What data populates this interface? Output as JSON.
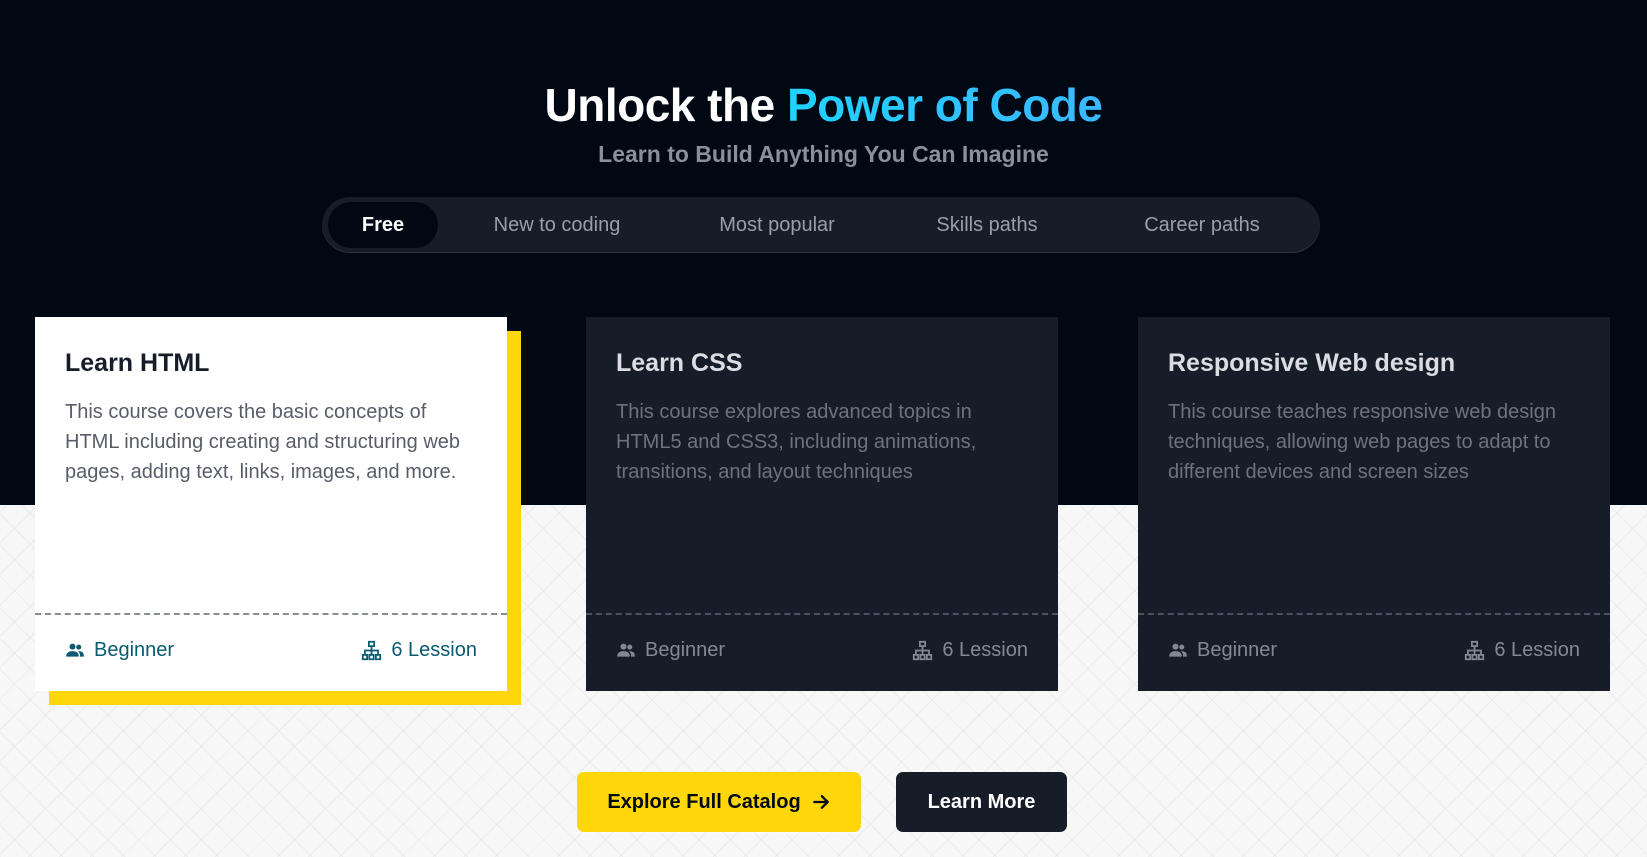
{
  "hero": {
    "title_prefix": "Unlock the",
    "title_highlight": "Power of Code",
    "subtitle": "Learn to Build Anything You Can Imagine"
  },
  "tabs": [
    {
      "label": "Free",
      "active": true
    },
    {
      "label": "New to coding",
      "active": false
    },
    {
      "label": "Most popular",
      "active": false
    },
    {
      "label": "Skills paths",
      "active": false
    },
    {
      "label": "Career paths",
      "active": false
    }
  ],
  "cards": [
    {
      "title": "Learn HTML",
      "description": "This course covers the basic concepts of HTML including creating and structuring web pages, adding text, links, images, and more.",
      "level": "Beginner",
      "lessons": "6 Lession",
      "highlighted": true
    },
    {
      "title": "Learn CSS",
      "description": "This course explores advanced topics in HTML5 and CSS3, including animations, transitions, and layout techniques",
      "level": "Beginner",
      "lessons": "6 Lession",
      "highlighted": false
    },
    {
      "title": "Responsive Web design",
      "description": "This course teaches responsive web design techniques, allowing web pages to adapt to different devices and screen sizes",
      "level": "Beginner",
      "lessons": "6 Lession",
      "highlighted": false
    }
  ],
  "buttons": {
    "explore_label": "Explore Full Catalog",
    "learn_more_label": "Learn More"
  },
  "icons": {
    "users": "users-icon",
    "lessons": "hierarchy-icon",
    "arrow": "arrow-right-icon"
  },
  "colors": {
    "background_dark": "#000814",
    "card_dark": "#161d29",
    "accent_yellow": "#ffd60a",
    "accent_cyan": "#1fd2ff",
    "meta_highlight": "#0a5a72"
  }
}
